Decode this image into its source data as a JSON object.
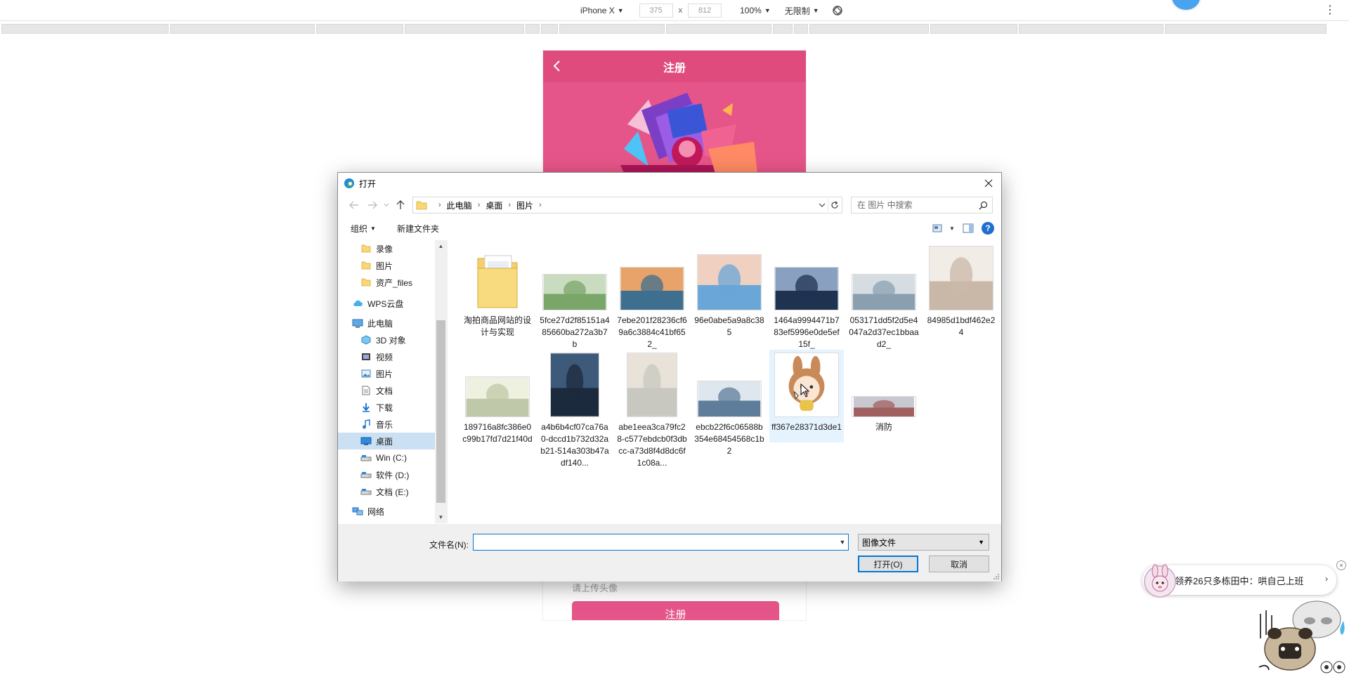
{
  "devtools": {
    "device": "iPhone X",
    "width_value": "375",
    "height_value": "812",
    "times_sign": "x",
    "zoom": "100%",
    "throttle": "无限制",
    "more_glyph": "⋮"
  },
  "phone": {
    "header_title": "注册",
    "avatar_hint": "请上传头像",
    "register_button": "注册",
    "accent_color": "#e04b7d"
  },
  "dialog": {
    "title": "打开",
    "breadcrumb": [
      "此电脑",
      "桌面",
      "图片"
    ],
    "search_placeholder": "在 图片 中搜索",
    "toolbar": {
      "organize": "组织",
      "new_folder": "新建文件夹",
      "help_glyph": "?"
    },
    "nav_items": [
      {
        "label": "录像",
        "icon": "folder-icon"
      },
      {
        "label": "图片",
        "icon": "folder-icon"
      },
      {
        "label": "资产_files",
        "icon": "folder-icon"
      },
      {
        "label": "WPS云盘",
        "icon": "cloud-icon"
      },
      {
        "label": "此电脑",
        "icon": "computer-icon"
      },
      {
        "label": "3D 对象",
        "icon": "cube-icon"
      },
      {
        "label": "视频",
        "icon": "video-icon"
      },
      {
        "label": "图片",
        "icon": "pictures-icon"
      },
      {
        "label": "文档",
        "icon": "document-icon"
      },
      {
        "label": "下载",
        "icon": "download-icon"
      },
      {
        "label": "音乐",
        "icon": "music-icon"
      },
      {
        "label": "桌面",
        "icon": "desktop-icon"
      },
      {
        "label": "Win (C:)",
        "icon": "drive-icon"
      },
      {
        "label": "软件 (D:)",
        "icon": "drive-icon"
      },
      {
        "label": "文档 (E:)",
        "icon": "drive-icon"
      },
      {
        "label": "网络",
        "icon": "network-icon"
      }
    ],
    "files": [
      {
        "label": "淘拍商品网站的设计与实现",
        "kind": "folder"
      },
      {
        "label": "5fce27d2f85151a485660ba272a3b7b",
        "kind": "image"
      },
      {
        "label": "7ebe201f28236cf69a6c3884c41bf652_",
        "kind": "image"
      },
      {
        "label": "96e0abe5a9a8c385",
        "kind": "image"
      },
      {
        "label": "1464a9994471b783ef5996e0de5ef15f_",
        "kind": "image"
      },
      {
        "label": "053171dd5f2d5e4047a2d37ec1bbaad2_",
        "kind": "image"
      },
      {
        "label": "84985d1bdf462e24",
        "kind": "image"
      },
      {
        "label": "189716a8fc386e0c99b17fd7d21f40d",
        "kind": "image"
      },
      {
        "label": "a4b6b4cf07ca76a0-dccd1b732d32ab21-514a303b47adf140...",
        "kind": "image"
      },
      {
        "label": "abe1eea3ca79fc28-c577ebdcb0f3dbcc-a73d8f4d8dc6f1c08a...",
        "kind": "image"
      },
      {
        "label": "ebcb22f6c06588b354e68454568c1b2",
        "kind": "image"
      },
      {
        "label": "ff367e28371d3de1",
        "kind": "image"
      },
      {
        "label": "消防",
        "kind": "image"
      }
    ],
    "filename_label": "文件名(N):",
    "filename_value": "",
    "filetype": "图像文件",
    "open_button": "打开(O)",
    "cancel_button": "取消"
  },
  "notification": {
    "text": "领养26只多栋田中：哄自己上班",
    "chevron": "›",
    "close_glyph": "×"
  }
}
